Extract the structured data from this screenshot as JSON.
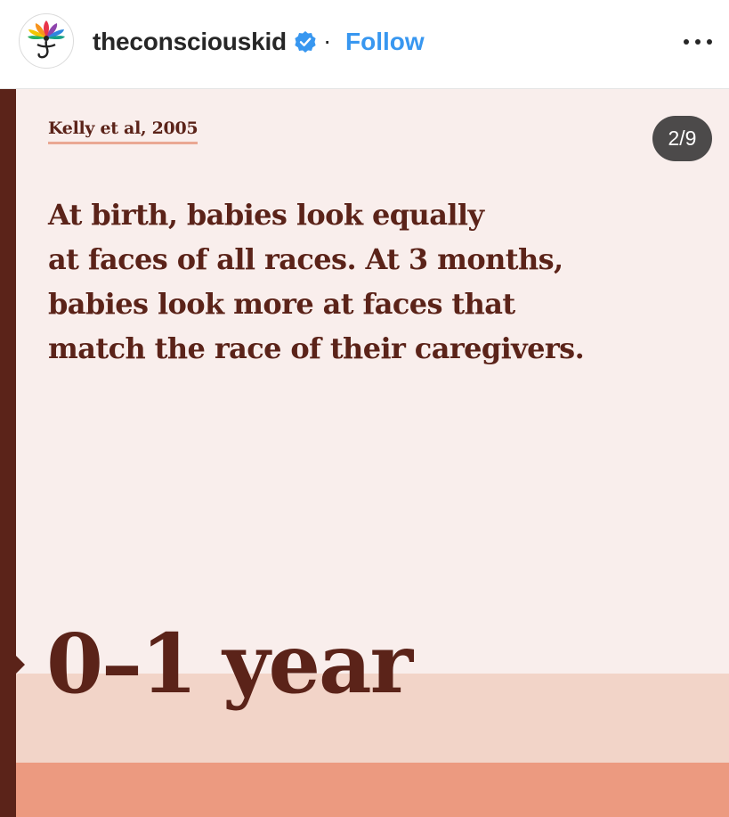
{
  "header": {
    "username": "theconsciouskid",
    "separator": "·",
    "follow_label": "Follow",
    "avatar_icon": "lotus-figure-logo",
    "verified_icon": "verified-badge-icon",
    "more_icon": "more-options-icon"
  },
  "post": {
    "citation": "Kelly et al, 2005",
    "body_lines": [
      "At birth, babies look equally",
      "at faces of all races. At 3 months,",
      "babies look more at faces that",
      "match the race of their caregivers."
    ],
    "big_title": "0–1 year",
    "counter": "2/9"
  },
  "colors": {
    "brand_text": "#5b2319",
    "background": "#f9eeec",
    "band_light": "#f2d4c8",
    "band_orange": "#ec9a80",
    "follow_blue": "#3897f0",
    "verified_blue": "#3897f0"
  }
}
